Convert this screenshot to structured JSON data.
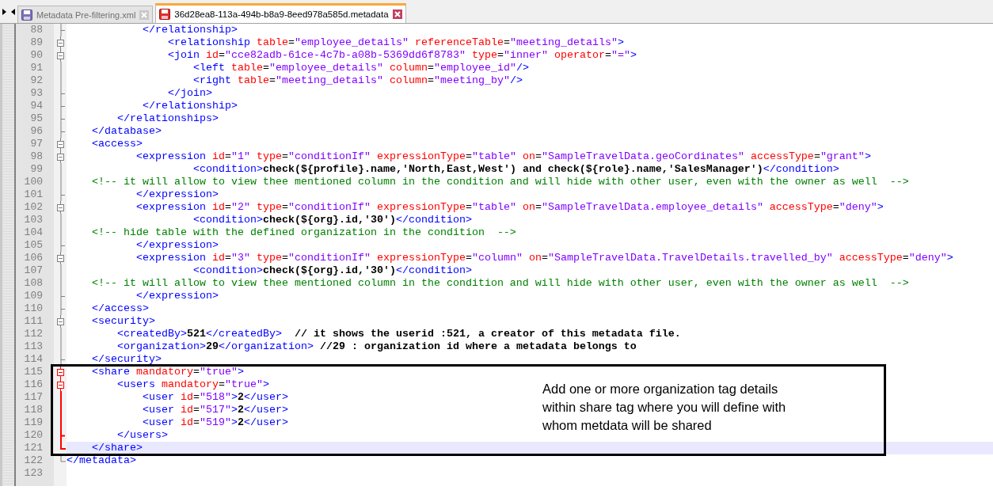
{
  "tabs": [
    {
      "label": "Metadata Pre-filtering.xml",
      "selected": false,
      "modified": false
    },
    {
      "label": "36d28ea8-113a-494b-b8a9-8eed978a585d.metadata",
      "selected": true,
      "modified": true
    }
  ],
  "editor": {
    "lines": [
      {
        "number": "88",
        "fold": {
          "kind": "tick",
          "active": false
        },
        "current": false,
        "tokens": [
          {
            "kind": "tag",
            "text": "            </relationship>"
          }
        ]
      },
      {
        "number": "89",
        "fold": {
          "kind": "box",
          "active": false
        },
        "current": false,
        "tokens": [
          {
            "kind": "tag",
            "text": "                <relationship"
          },
          {
            "kind": "attr",
            "text": " table"
          },
          {
            "kind": "eq",
            "text": "="
          },
          {
            "kind": "value",
            "text": "\"employee_details\""
          },
          {
            "kind": "attr",
            "text": " referenceTable"
          },
          {
            "kind": "eq",
            "text": "="
          },
          {
            "kind": "value",
            "text": "\"meeting_details\""
          },
          {
            "kind": "tag",
            "text": ">"
          }
        ]
      },
      {
        "number": "90",
        "fold": {
          "kind": "box",
          "active": false
        },
        "current": false,
        "tokens": [
          {
            "kind": "tag",
            "text": "                <join"
          },
          {
            "kind": "attr",
            "text": " id"
          },
          {
            "kind": "eq",
            "text": "="
          },
          {
            "kind": "value",
            "text": "\"cce82adb-61ce-4c7b-a08b-5369dd6f8783\""
          },
          {
            "kind": "attr",
            "text": " type"
          },
          {
            "kind": "eq",
            "text": "="
          },
          {
            "kind": "value",
            "text": "\"inner\""
          },
          {
            "kind": "attr",
            "text": " operator"
          },
          {
            "kind": "eq",
            "text": "="
          },
          {
            "kind": "value",
            "text": "\"=\""
          },
          {
            "kind": "tag",
            "text": ">"
          }
        ]
      },
      {
        "number": "91",
        "fold": {
          "kind": "line",
          "active": false
        },
        "current": false,
        "tokens": [
          {
            "kind": "tag",
            "text": "                    <left"
          },
          {
            "kind": "attr",
            "text": " table"
          },
          {
            "kind": "eq",
            "text": "="
          },
          {
            "kind": "value",
            "text": "\"employee_details\""
          },
          {
            "kind": "attr",
            "text": " column"
          },
          {
            "kind": "eq",
            "text": "="
          },
          {
            "kind": "value",
            "text": "\"employee_id\""
          },
          {
            "kind": "tag",
            "text": "/>"
          }
        ]
      },
      {
        "number": "92",
        "fold": {
          "kind": "line",
          "active": false
        },
        "current": false,
        "tokens": [
          {
            "kind": "tag",
            "text": "                    <right"
          },
          {
            "kind": "attr",
            "text": " table"
          },
          {
            "kind": "eq",
            "text": "="
          },
          {
            "kind": "value",
            "text": "\"meeting_details\""
          },
          {
            "kind": "attr",
            "text": " column"
          },
          {
            "kind": "eq",
            "text": "="
          },
          {
            "kind": "value",
            "text": "\"meeting_by\""
          },
          {
            "kind": "tag",
            "text": "/>"
          }
        ]
      },
      {
        "number": "93",
        "fold": {
          "kind": "tick",
          "active": false
        },
        "current": false,
        "tokens": [
          {
            "kind": "tag",
            "text": "                </join>"
          }
        ]
      },
      {
        "number": "94",
        "fold": {
          "kind": "tick",
          "active": false
        },
        "current": false,
        "tokens": [
          {
            "kind": "tag",
            "text": "            </relationship>"
          }
        ]
      },
      {
        "number": "95",
        "fold": {
          "kind": "tick",
          "active": false
        },
        "current": false,
        "tokens": [
          {
            "kind": "tag",
            "text": "        </relationships>"
          }
        ]
      },
      {
        "number": "96",
        "fold": {
          "kind": "tick",
          "active": false
        },
        "current": false,
        "tokens": [
          {
            "kind": "tag",
            "text": "    </database>"
          }
        ]
      },
      {
        "number": "97",
        "fold": {
          "kind": "box",
          "active": false
        },
        "current": false,
        "tokens": [
          {
            "kind": "tag",
            "text": "    <access>"
          }
        ]
      },
      {
        "number": "98",
        "fold": {
          "kind": "box",
          "active": false
        },
        "current": false,
        "tokens": [
          {
            "kind": "tag",
            "text": "           <expression"
          },
          {
            "kind": "attr",
            "text": " id"
          },
          {
            "kind": "eq",
            "text": "="
          },
          {
            "kind": "value",
            "text": "\"1\""
          },
          {
            "kind": "attr",
            "text": " type"
          },
          {
            "kind": "eq",
            "text": "="
          },
          {
            "kind": "value",
            "text": "\"conditionIf\""
          },
          {
            "kind": "attr",
            "text": " expressionType"
          },
          {
            "kind": "eq",
            "text": "="
          },
          {
            "kind": "value",
            "text": "\"table\""
          },
          {
            "kind": "attr",
            "text": " on"
          },
          {
            "kind": "eq",
            "text": "="
          },
          {
            "kind": "value",
            "text": "\"SampleTravelData.geoCordinates\""
          },
          {
            "kind": "attr",
            "text": " accessType"
          },
          {
            "kind": "eq",
            "text": "="
          },
          {
            "kind": "value",
            "text": "\"grant\""
          },
          {
            "kind": "tag",
            "text": ">"
          }
        ]
      },
      {
        "number": "99",
        "fold": {
          "kind": "line",
          "active": false
        },
        "current": false,
        "tokens": [
          {
            "kind": "tag",
            "text": "                    <condition>"
          },
          {
            "kind": "text",
            "text": "check(${profile}.name,'North,East,West') and check(${role}.name,'SalesManager')"
          },
          {
            "kind": "tag",
            "text": "</condition>"
          }
        ]
      },
      {
        "number": "100",
        "fold": {
          "kind": "line",
          "active": false
        },
        "current": false,
        "tokens": [
          {
            "kind": "comment",
            "text": "    <!-- it will allow to view thee mentioned column in the condition and will hide with other user, even with the owner as well  -->"
          }
        ]
      },
      {
        "number": "101",
        "fold": {
          "kind": "tick",
          "active": false
        },
        "current": false,
        "tokens": [
          {
            "kind": "tag",
            "text": "           </expression>"
          }
        ]
      },
      {
        "number": "102",
        "fold": {
          "kind": "box",
          "active": false
        },
        "current": false,
        "tokens": [
          {
            "kind": "tag",
            "text": "           <expression"
          },
          {
            "kind": "attr",
            "text": " id"
          },
          {
            "kind": "eq",
            "text": "="
          },
          {
            "kind": "value",
            "text": "\"2\""
          },
          {
            "kind": "attr",
            "text": " type"
          },
          {
            "kind": "eq",
            "text": "="
          },
          {
            "kind": "value",
            "text": "\"conditionIf\""
          },
          {
            "kind": "attr",
            "text": " expressionType"
          },
          {
            "kind": "eq",
            "text": "="
          },
          {
            "kind": "value",
            "text": "\"table\""
          },
          {
            "kind": "attr",
            "text": " on"
          },
          {
            "kind": "eq",
            "text": "="
          },
          {
            "kind": "value",
            "text": "\"SampleTravelData.employee_details\""
          },
          {
            "kind": "attr",
            "text": " accessType"
          },
          {
            "kind": "eq",
            "text": "="
          },
          {
            "kind": "value",
            "text": "\"deny\""
          },
          {
            "kind": "tag",
            "text": ">"
          }
        ]
      },
      {
        "number": "103",
        "fold": {
          "kind": "line",
          "active": false
        },
        "current": false,
        "tokens": [
          {
            "kind": "tag",
            "text": "                    <condition>"
          },
          {
            "kind": "text",
            "text": "check(${org}.id,'30')"
          },
          {
            "kind": "tag",
            "text": "</condition>"
          }
        ]
      },
      {
        "number": "104",
        "fold": {
          "kind": "line",
          "active": false
        },
        "current": false,
        "tokens": [
          {
            "kind": "comment",
            "text": "    <!-- hide table with the defined organization in the condition  -->"
          }
        ]
      },
      {
        "number": "105",
        "fold": {
          "kind": "tick",
          "active": false
        },
        "current": false,
        "tokens": [
          {
            "kind": "tag",
            "text": "           </expression>"
          }
        ]
      },
      {
        "number": "106",
        "fold": {
          "kind": "box",
          "active": false
        },
        "current": false,
        "tokens": [
          {
            "kind": "tag",
            "text": "           <expression"
          },
          {
            "kind": "attr",
            "text": " id"
          },
          {
            "kind": "eq",
            "text": "="
          },
          {
            "kind": "value",
            "text": "\"3\""
          },
          {
            "kind": "attr",
            "text": " type"
          },
          {
            "kind": "eq",
            "text": "="
          },
          {
            "kind": "value",
            "text": "\"conditionIf\""
          },
          {
            "kind": "attr",
            "text": " expressionType"
          },
          {
            "kind": "eq",
            "text": "="
          },
          {
            "kind": "value",
            "text": "\"column\""
          },
          {
            "kind": "attr",
            "text": " on"
          },
          {
            "kind": "eq",
            "text": "="
          },
          {
            "kind": "value",
            "text": "\"SampleTravelData.TravelDetails.travelled_by\""
          },
          {
            "kind": "attr",
            "text": " accessType"
          },
          {
            "kind": "eq",
            "text": "="
          },
          {
            "kind": "value",
            "text": "\"deny\""
          },
          {
            "kind": "tag",
            "text": ">"
          }
        ]
      },
      {
        "number": "107",
        "fold": {
          "kind": "line",
          "active": false
        },
        "current": false,
        "tokens": [
          {
            "kind": "tag",
            "text": "                    <condition>"
          },
          {
            "kind": "text",
            "text": "check(${org}.id,'30')"
          },
          {
            "kind": "tag",
            "text": "</condition>"
          }
        ]
      },
      {
        "number": "108",
        "fold": {
          "kind": "line",
          "active": false
        },
        "current": false,
        "tokens": [
          {
            "kind": "comment",
            "text": "    <!-- it will allow to view thee mentioned column in the condition and will hide with other user, even with the owner as well  -->"
          }
        ]
      },
      {
        "number": "109",
        "fold": {
          "kind": "tick",
          "active": false
        },
        "current": false,
        "tokens": [
          {
            "kind": "tag",
            "text": "           </expression>"
          }
        ]
      },
      {
        "number": "110",
        "fold": {
          "kind": "tick",
          "active": false
        },
        "current": false,
        "tokens": [
          {
            "kind": "tag",
            "text": "    </access>"
          }
        ]
      },
      {
        "number": "111",
        "fold": {
          "kind": "box",
          "active": false
        },
        "current": false,
        "tokens": [
          {
            "kind": "tag",
            "text": "    <security>"
          }
        ]
      },
      {
        "number": "112",
        "fold": {
          "kind": "line",
          "active": false
        },
        "current": false,
        "tokens": [
          {
            "kind": "tag",
            "text": "        <createdBy>"
          },
          {
            "kind": "text",
            "text": "521"
          },
          {
            "kind": "tag",
            "text": "</createdBy>"
          },
          {
            "kind": "text",
            "text": "  // it shows the userid :521, a creator of this metadata file."
          }
        ]
      },
      {
        "number": "113",
        "fold": {
          "kind": "line",
          "active": false
        },
        "current": false,
        "tokens": [
          {
            "kind": "tag",
            "text": "        <organization>"
          },
          {
            "kind": "text",
            "text": "29"
          },
          {
            "kind": "tag",
            "text": "</organization>"
          },
          {
            "kind": "text",
            "text": " //29 : organization id where a metadata belongs to"
          }
        ]
      },
      {
        "number": "114",
        "fold": {
          "kind": "tick",
          "active": false
        },
        "current": false,
        "tokens": [
          {
            "kind": "tag",
            "text": "    </security>"
          }
        ]
      },
      {
        "number": "115",
        "fold": {
          "kind": "box",
          "active": true
        },
        "current": false,
        "tokens": [
          {
            "kind": "tag",
            "text": "    <share"
          },
          {
            "kind": "attr",
            "text": " mandatory"
          },
          {
            "kind": "eq",
            "text": "="
          },
          {
            "kind": "value",
            "text": "\"true\""
          },
          {
            "kind": "tag",
            "text": ">"
          }
        ]
      },
      {
        "number": "116",
        "fold": {
          "kind": "box",
          "active": true
        },
        "current": false,
        "tokens": [
          {
            "kind": "tag",
            "text": "        <users"
          },
          {
            "kind": "attr",
            "text": " mandatory"
          },
          {
            "kind": "eq",
            "text": "="
          },
          {
            "kind": "value",
            "text": "\"true\""
          },
          {
            "kind": "tag",
            "text": ">"
          }
        ]
      },
      {
        "number": "117",
        "fold": {
          "kind": "line",
          "active": true
        },
        "current": false,
        "tokens": [
          {
            "kind": "tag",
            "text": "            <user"
          },
          {
            "kind": "attr",
            "text": " id"
          },
          {
            "kind": "eq",
            "text": "="
          },
          {
            "kind": "value",
            "text": "\"518\""
          },
          {
            "kind": "tag",
            "text": ">"
          },
          {
            "kind": "text",
            "text": "2"
          },
          {
            "kind": "tag",
            "text": "</user>"
          }
        ]
      },
      {
        "number": "118",
        "fold": {
          "kind": "line",
          "active": true
        },
        "current": false,
        "tokens": [
          {
            "kind": "tag",
            "text": "            <user"
          },
          {
            "kind": "attr",
            "text": " id"
          },
          {
            "kind": "eq",
            "text": "="
          },
          {
            "kind": "value",
            "text": "\"517\""
          },
          {
            "kind": "tag",
            "text": ">"
          },
          {
            "kind": "text",
            "text": "2"
          },
          {
            "kind": "tag",
            "text": "</user>"
          }
        ]
      },
      {
        "number": "119",
        "fold": {
          "kind": "line",
          "active": true
        },
        "current": false,
        "tokens": [
          {
            "kind": "tag",
            "text": "            <user"
          },
          {
            "kind": "attr",
            "text": " id"
          },
          {
            "kind": "eq",
            "text": "="
          },
          {
            "kind": "value",
            "text": "\"519\""
          },
          {
            "kind": "tag",
            "text": ">"
          },
          {
            "kind": "text",
            "text": "2"
          },
          {
            "kind": "tag",
            "text": "</user>"
          }
        ]
      },
      {
        "number": "120",
        "fold": {
          "kind": "tick",
          "active": true
        },
        "current": false,
        "tokens": [
          {
            "kind": "tag",
            "text": "        </users>"
          }
        ]
      },
      {
        "number": "121",
        "fold": {
          "kind": "end",
          "active": true
        },
        "current": true,
        "tokens": [
          {
            "kind": "tag",
            "text": "    </share>"
          }
        ]
      },
      {
        "number": "122",
        "fold": {
          "kind": "end",
          "active": false
        },
        "current": false,
        "tokens": [
          {
            "kind": "tag",
            "text": "</metadata>"
          }
        ]
      },
      {
        "number": "123",
        "current": false
      }
    ]
  },
  "annotation": {
    "lines": [
      "Add one or more organization tag details",
      "within share tag where you will define with",
      "whom metdata will be shared"
    ]
  }
}
